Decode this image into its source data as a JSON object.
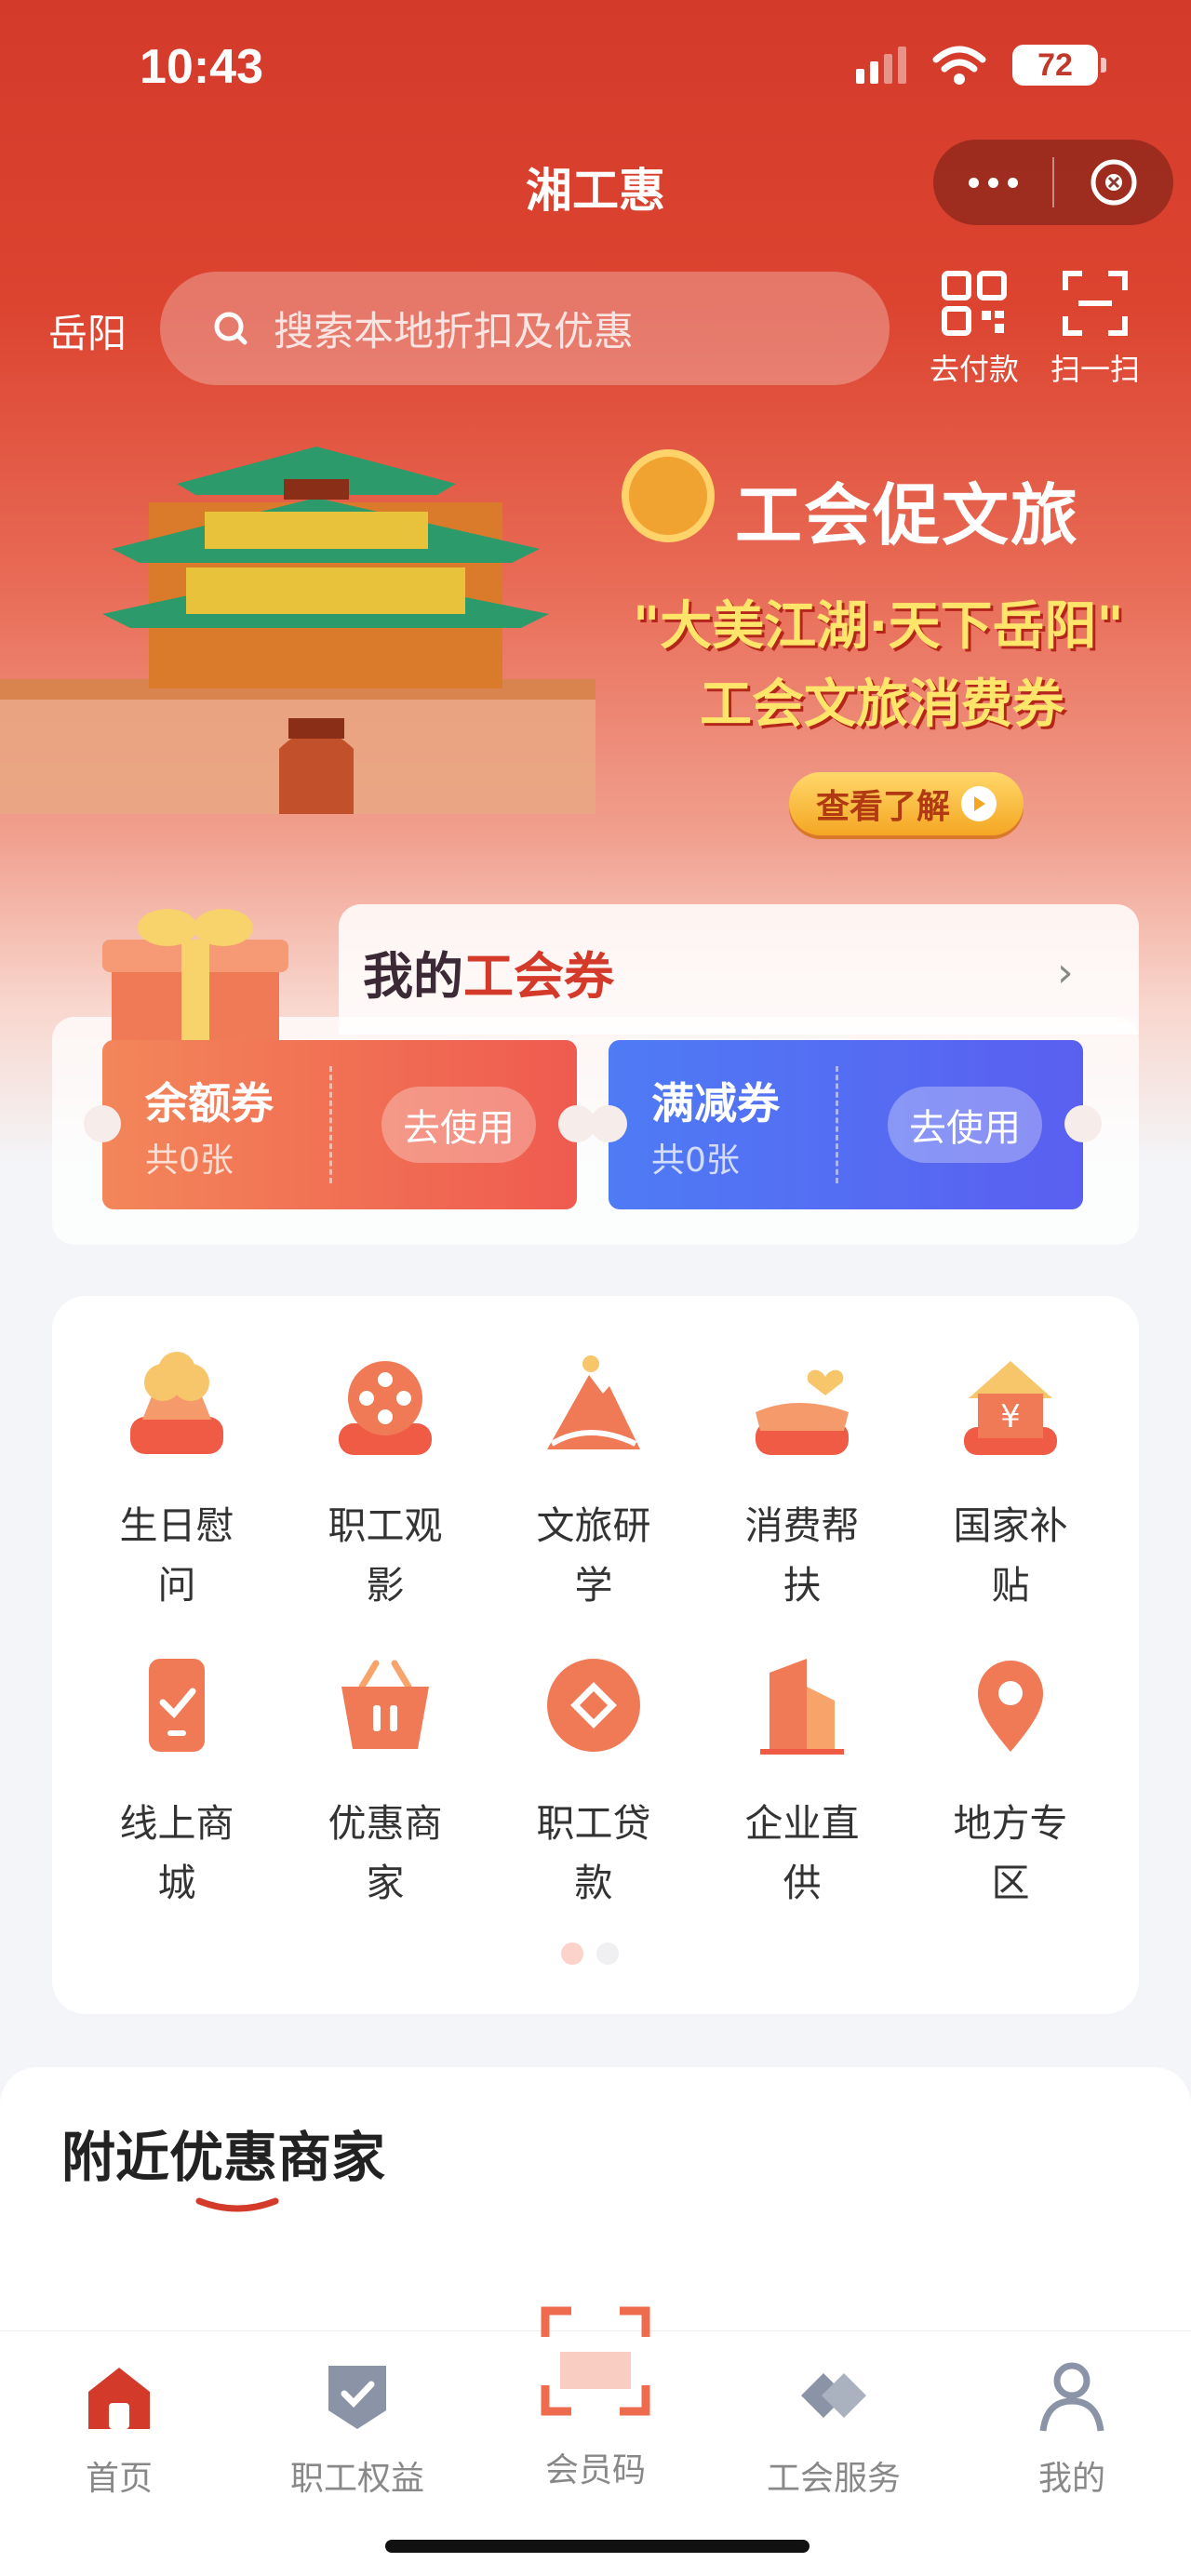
{
  "status_bar": {
    "time": "10:43",
    "battery": "72"
  },
  "header": {
    "title": "湘工惠"
  },
  "search": {
    "city": "岳阳",
    "placeholder": "搜索本地折扣及优惠"
  },
  "top_actions": {
    "pay": "去付款",
    "scan": "扫一扫"
  },
  "banner": {
    "title": "工会促文旅",
    "line1": "\"大美江湖·天下岳阳\"",
    "line2": "工会文旅消费券",
    "button": "查看了解"
  },
  "coupons": {
    "heading_prefix": "我的",
    "heading_highlight": "工会券",
    "items": [
      {
        "name": "余额券",
        "count": "共0张",
        "action": "去使用"
      },
      {
        "name": "满减券",
        "count": "共0张",
        "action": "去使用"
      }
    ]
  },
  "services": [
    {
      "label": "生日慰问",
      "icon": "cake-icon"
    },
    {
      "label": "职工观影",
      "icon": "film-reel-icon"
    },
    {
      "label": "文旅研学",
      "icon": "mountain-icon"
    },
    {
      "label": "消费帮扶",
      "icon": "hand-heart-icon"
    },
    {
      "label": "国家补贴",
      "icon": "yuan-house-icon"
    },
    {
      "label": "线上商城",
      "icon": "phone-check-icon"
    },
    {
      "label": "优惠商家",
      "icon": "basket-icon"
    },
    {
      "label": "职工贷款",
      "icon": "coin-icon"
    },
    {
      "label": "企业直供",
      "icon": "building-icon"
    },
    {
      "label": "地方专区",
      "icon": "location-pin-icon"
    }
  ],
  "nearby": {
    "title": "附近优惠商家"
  },
  "tabbar": [
    {
      "label": "首页",
      "icon": "home-icon"
    },
    {
      "label": "职工权益",
      "icon": "shield-check-icon"
    },
    {
      "label": "会员码",
      "icon": "scan-frame-icon"
    },
    {
      "label": "工会服务",
      "icon": "handshake-icon"
    },
    {
      "label": "我的",
      "icon": "user-icon"
    }
  ],
  "colors": {
    "brand_red": "#d43a2a",
    "coupon_orange": "#ef5b4f",
    "coupon_blue": "#5a5ff0"
  }
}
